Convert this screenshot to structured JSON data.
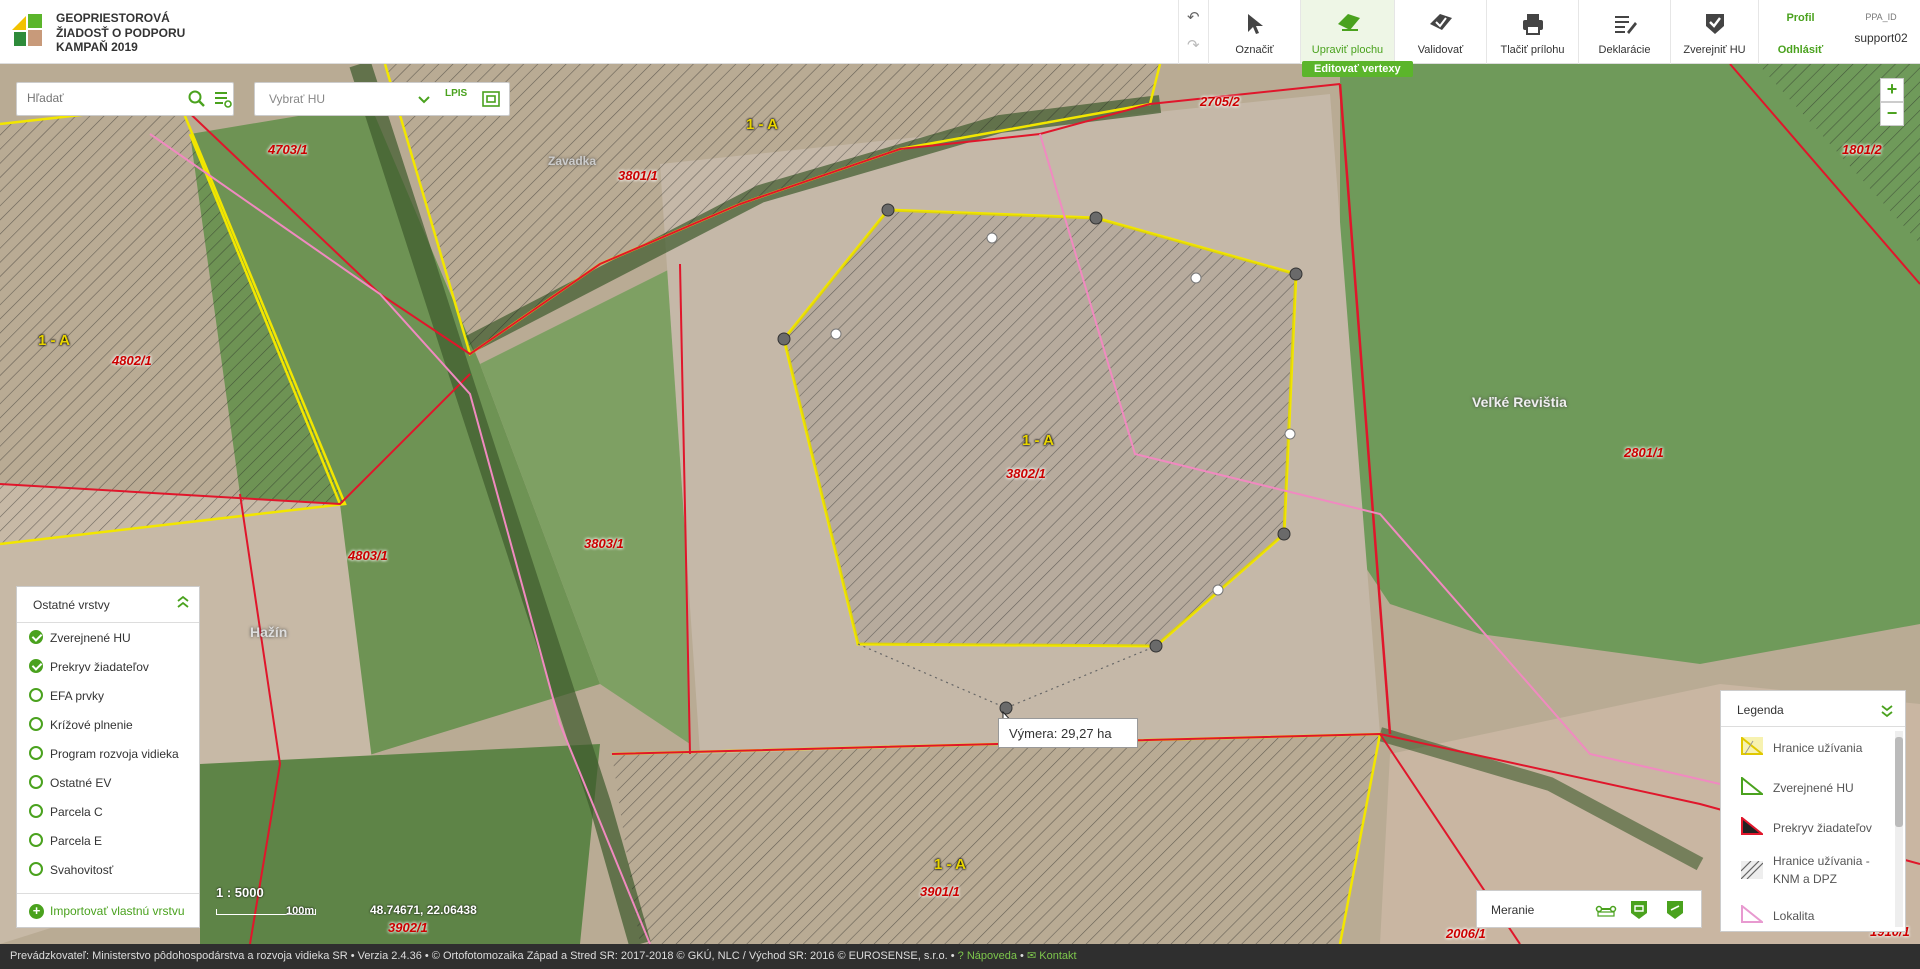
{
  "header": {
    "title_lines": [
      "GEOPRIESTOROVÁ",
      "ŽIADOSŤ O PODPORU",
      "KAMPAŇ 2019"
    ],
    "tools": [
      {
        "label": "Označiť"
      },
      {
        "label": "Upraviť plochu",
        "active": true,
        "sub": "Editovať vertexy"
      },
      {
        "label": "Validovať"
      },
      {
        "label": "Tlačiť prílohu"
      },
      {
        "label": "Deklarácie"
      },
      {
        "label": "Zverejniť HU"
      }
    ],
    "profile": "Profil",
    "logout": "Odhlásiť",
    "user_id_label": "PPA_ID",
    "user": "support02"
  },
  "search": {
    "placeholder": "Hľadať"
  },
  "hu_select": {
    "placeholder": "Vybrať HU",
    "lpis": "LPIS"
  },
  "map": {
    "parcels": [
      "4703/1",
      "3801/1",
      "2705/2",
      "1801/2",
      "4802/1",
      "3802/1",
      "2801/1",
      "4803/1",
      "3803/1",
      "3901/1",
      "3902/1",
      "2006/1",
      "1910/1"
    ],
    "zones": [
      "1 - A",
      "1 - A",
      "1 - A",
      "1 - A"
    ],
    "towns": [
      "Veľké Revištia",
      "Hažín",
      "Zavadka"
    ],
    "tooltip": "Výmera: 29,27 ha",
    "scale": "1 : 5000",
    "scale_len": "100m",
    "coords": "48.74671, 22.06438"
  },
  "layers": {
    "title": "Ostatné vrstvy",
    "items": [
      {
        "label": "Zverejnené HU",
        "checked": true
      },
      {
        "label": "Prekryv žiadateľov",
        "checked": true
      },
      {
        "label": "EFA prvky",
        "checked": false
      },
      {
        "label": "Krížové plnenie",
        "checked": false
      },
      {
        "label": "Program rozvoja vidieka",
        "checked": false
      },
      {
        "label": "Ostatné EV",
        "checked": false
      },
      {
        "label": "Parcela C",
        "checked": false
      },
      {
        "label": "Parcela E",
        "checked": false
      },
      {
        "label": "Svahovitosť",
        "checked": false
      }
    ],
    "import": "Importovať vlastnú vrstvu"
  },
  "measure": {
    "label": "Meranie"
  },
  "legend": {
    "title": "Legenda",
    "items": [
      "Hranice užívania",
      "Zverejnené HU",
      "Prekryv žiadateľov",
      "Hranice užívania - KNM a DPZ",
      "Lokalita"
    ]
  },
  "footer": {
    "text": "Prevádzkovateľ: Ministerstvo pôdohospodárstva a rozvoja vidieka SR • Verzia 2.4.36 • © Ortofotomozaika Západ a Stred SR: 2017-2018 © GKÚ, NLC / Východ SR: 2016 © EUROSENSE, s.r.o. •",
    "help": "Nápoveda",
    "contact": "Kontakt"
  },
  "colors": {
    "accent": "#4aa21e",
    "parcel_border": "#e0162b",
    "use_border": "#f2e600"
  }
}
